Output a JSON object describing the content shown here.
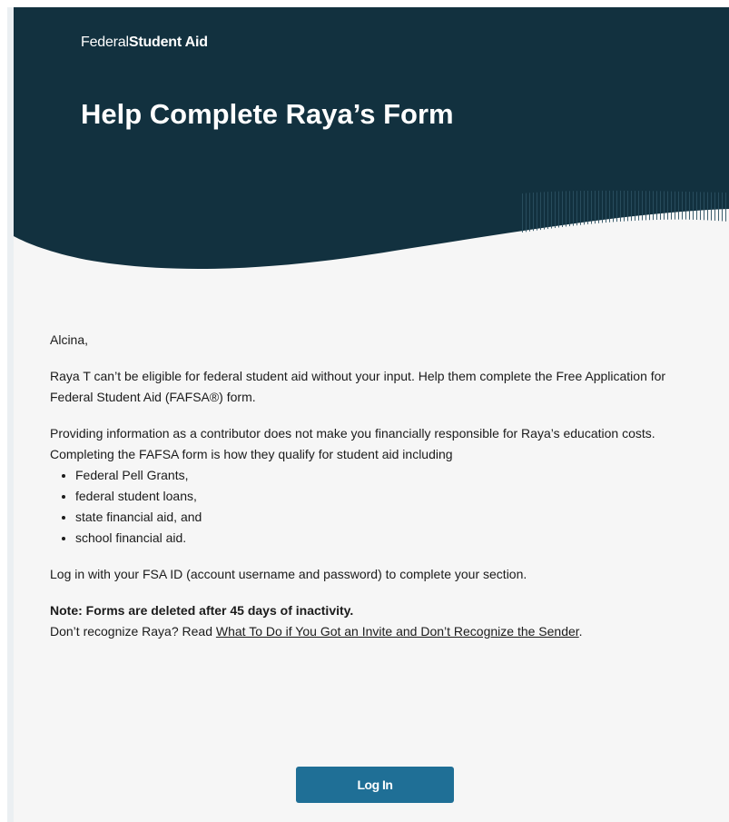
{
  "header": {
    "brand_federal": "Federal",
    "brand_student_aid": "Student Aid",
    "title": "Help Complete Raya’s Form"
  },
  "body": {
    "greeting": "Alcina,",
    "paragraph_1": "Raya T can’t be eligible for federal student aid without your input. Help them complete the Free Application for Federal Student Aid (FAFSA®) form.",
    "paragraph_2": "Providing information as a contributor does not make you financially responsible for Raya’s education costs. Completing the FAFSA form is how they qualify for student aid including",
    "aid_items": [
      "Federal Pell Grants,",
      "federal student loans,",
      "state financial aid, and",
      "school financial aid."
    ],
    "paragraph_3": "Log in with your FSA ID (account username and password) to complete your section.",
    "note": "Note: Forms are deleted after 45 days of inactivity.",
    "recognize_prefix": "Don’t recognize Raya? Read ",
    "recognize_link": "What To Do if You Got an Invite and Don’t Recognize the Sender",
    "recognize_suffix": "."
  },
  "actions": {
    "login_label": "Log In"
  },
  "colors": {
    "hero_background": "#12313f",
    "button": "#1f6f96",
    "card_background": "#f6f6f6"
  }
}
